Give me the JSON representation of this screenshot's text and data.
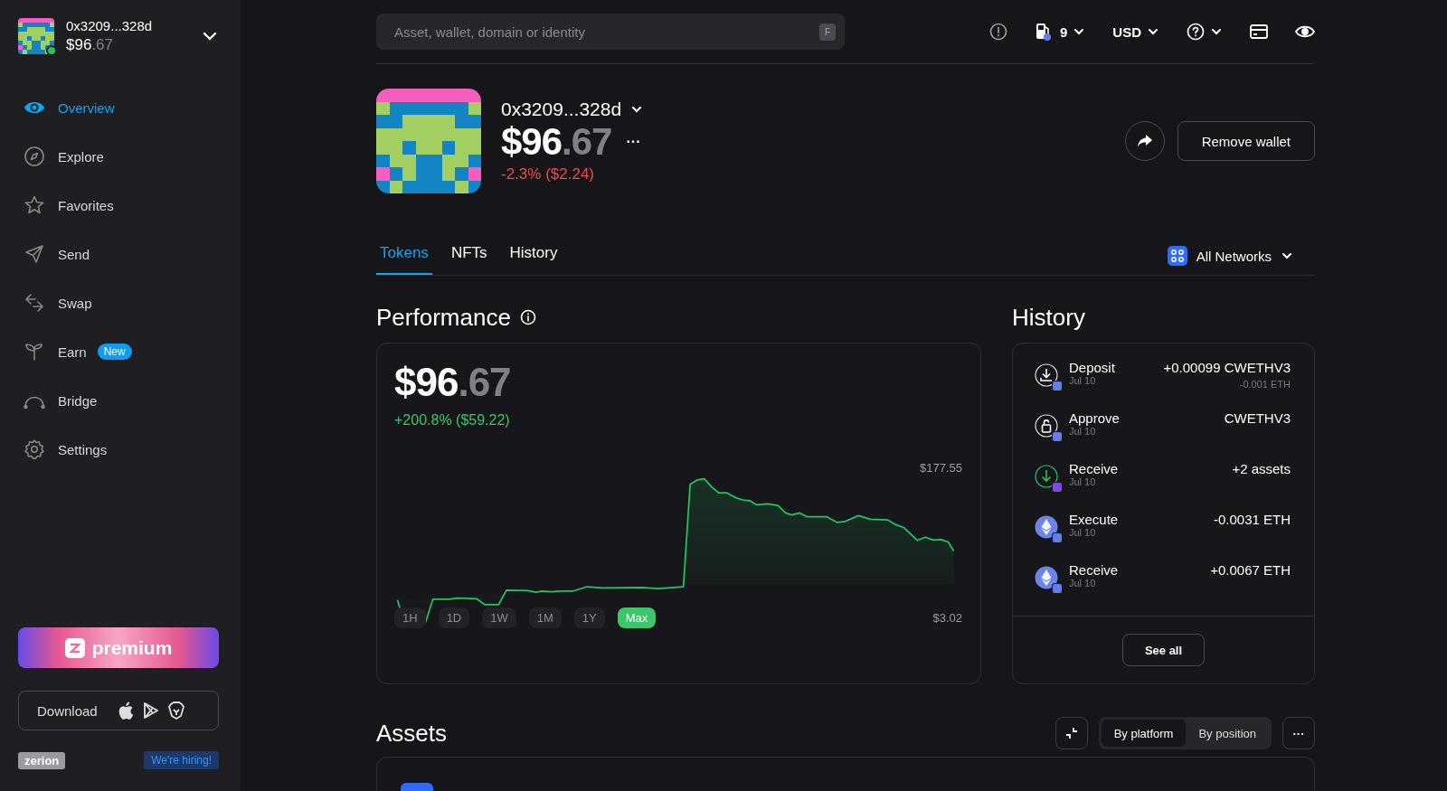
{
  "account": {
    "address": "0x3209...328d",
    "balance_whole": "$96",
    "balance_cents": ".67"
  },
  "nav": [
    {
      "label": "Overview",
      "kind": "eye",
      "selected": true
    },
    {
      "label": "Explore",
      "kind": "compass",
      "selected": false
    },
    {
      "label": "Favorites",
      "kind": "star",
      "selected": false
    },
    {
      "label": "Send",
      "kind": "send",
      "selected": false
    },
    {
      "label": "Swap",
      "kind": "swap",
      "selected": false
    },
    {
      "label": "Earn",
      "kind": "sprout",
      "selected": false,
      "badge": "New"
    },
    {
      "label": "Bridge",
      "kind": "bridge",
      "selected": false
    },
    {
      "label": "Settings",
      "kind": "gear",
      "selected": false
    }
  ],
  "premium": {
    "label": "premium"
  },
  "download": {
    "label": "Download"
  },
  "footer": {
    "logo": "zerion",
    "hiring": "We're hiring!"
  },
  "search": {
    "placeholder": "Asset, wallet, domain or identity",
    "shortcut": "F"
  },
  "toolbar": {
    "gas": "9",
    "currency": "USD"
  },
  "wallet": {
    "address": "0x3209...328d",
    "balance_whole": "$96",
    "balance_cents": ".67",
    "more": "···",
    "change": "-2.3% ($2.24)",
    "remove": "Remove wallet"
  },
  "tabs": [
    {
      "label": "Tokens",
      "selected": true
    },
    {
      "label": "NFTs",
      "selected": false
    },
    {
      "label": "History",
      "selected": false
    }
  ],
  "network": {
    "label": "All Networks"
  },
  "performance": {
    "title": "Performance",
    "value_whole": "$96",
    "value_cents": ".67",
    "change": "+200.8% ($59.22)",
    "max_label": "$177.55",
    "min_label": "$3.02",
    "periods": [
      {
        "label": "1H",
        "selected": false
      },
      {
        "label": "1D",
        "selected": false
      },
      {
        "label": "1W",
        "selected": false
      },
      {
        "label": "1M",
        "selected": false
      },
      {
        "label": "1Y",
        "selected": false
      },
      {
        "label": "Max",
        "selected": true
      }
    ]
  },
  "history": {
    "title": "History",
    "see_all": "See all",
    "items": [
      {
        "kind": "deposit",
        "color": "#627eea",
        "title": "Deposit",
        "date": "Jul 10",
        "amount": "+0.00099 CWETHV3",
        "sub": "-0.001 ETH"
      },
      {
        "kind": "approve",
        "color": "#627eea",
        "title": "Approve",
        "date": "Jul 10",
        "amount": "CWETHV3"
      },
      {
        "kind": "receive",
        "color": "#8247e5",
        "title": "Receive",
        "date": "Jul 10",
        "amount": "+2 assets"
      },
      {
        "kind": "eth",
        "color": "#627eea",
        "title": "Execute",
        "date": "Jul 10",
        "amount": "-0.0031 ETH"
      },
      {
        "kind": "eth",
        "color": "#627eea",
        "title": "Receive",
        "date": "Jul 10",
        "amount": "+0.0067 ETH"
      }
    ]
  },
  "assets": {
    "title": "Assets",
    "views": [
      {
        "label": "By platform",
        "selected": true
      },
      {
        "label": "By position",
        "selected": false
      }
    ],
    "more": "···"
  }
}
